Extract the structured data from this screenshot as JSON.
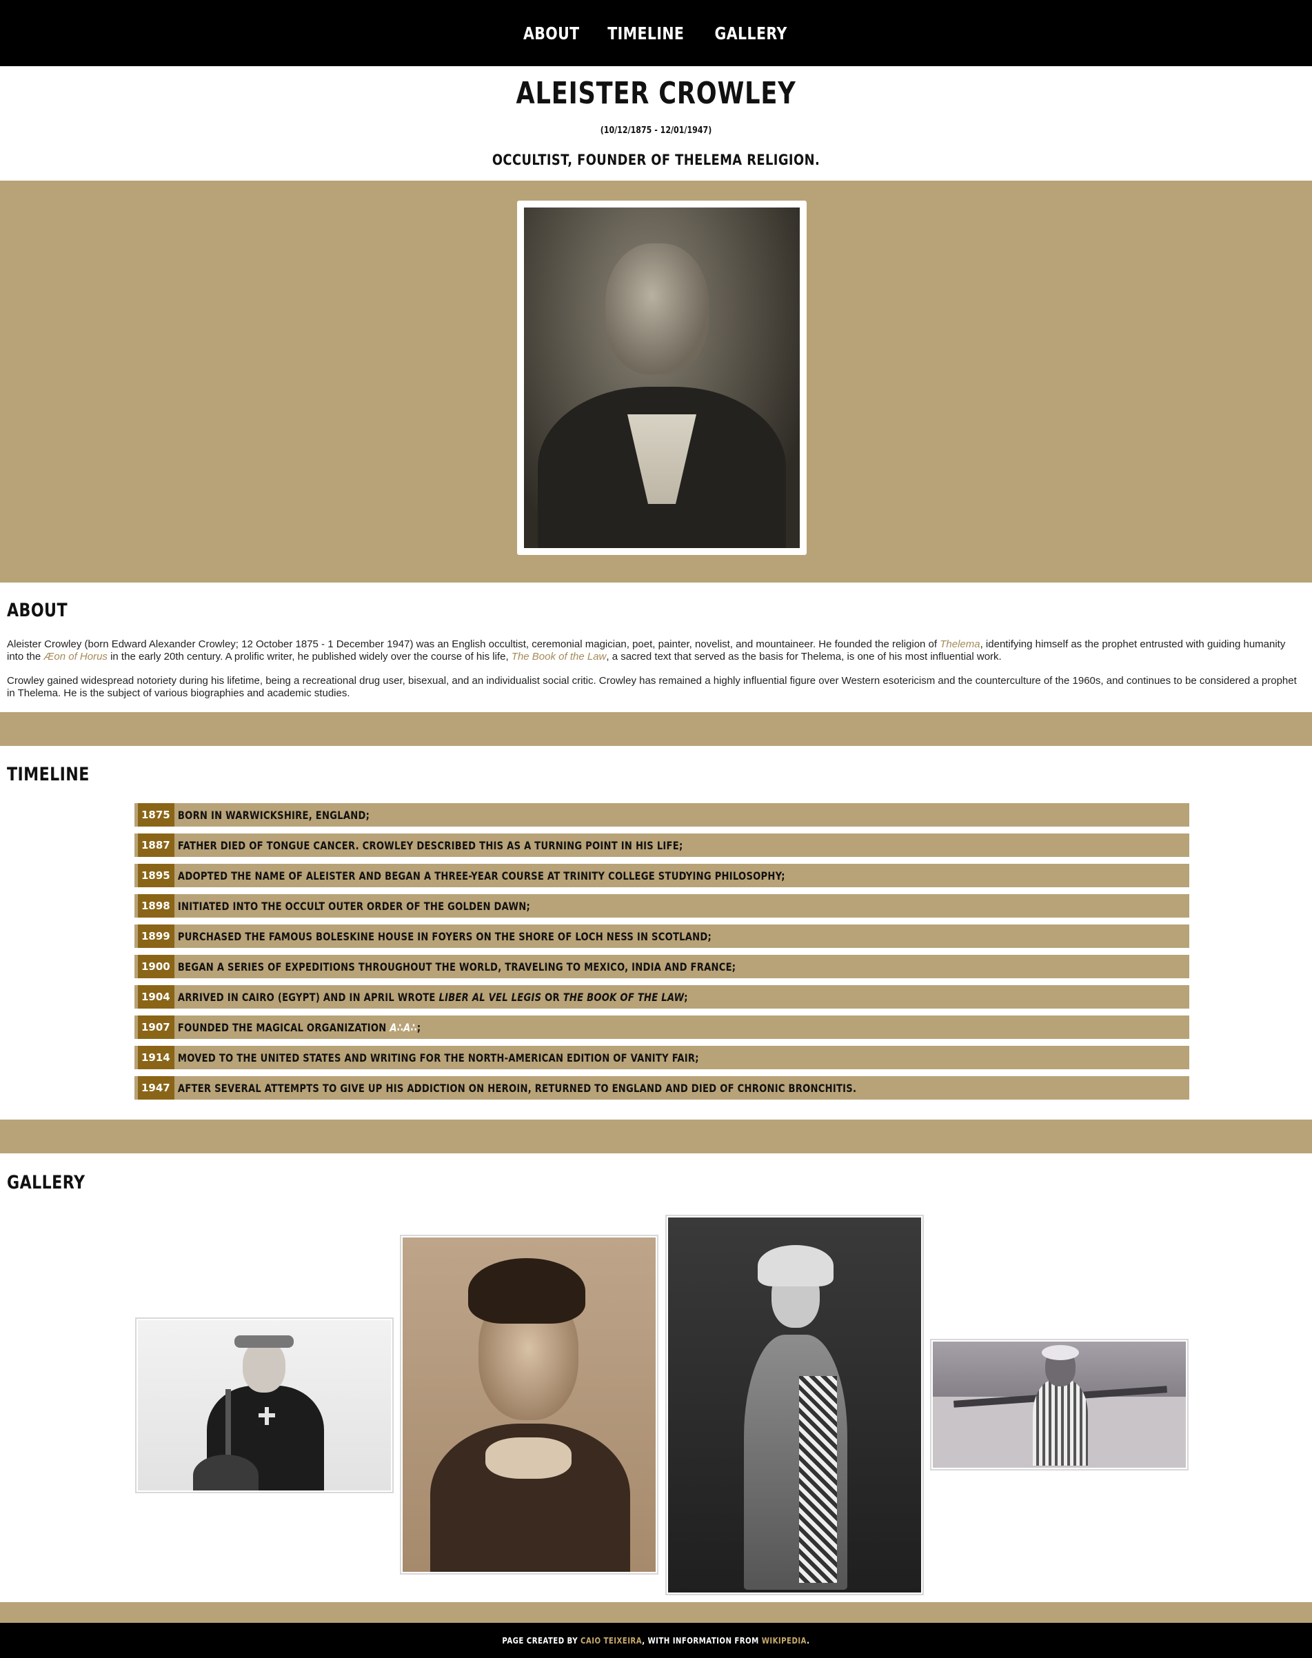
{
  "nav": {
    "items": [
      "ABOUT",
      "TIMELINE",
      "GALLERY"
    ]
  },
  "header": {
    "title": "ALEISTER CROWLEY",
    "dates": "(10/12/1875 - 12/01/1947)",
    "subtitle": "OCCULTIST, FOUNDER OF THELEMA RELIGION."
  },
  "about": {
    "heading": "ABOUT",
    "p1_a": "Aleister Crowley (born Edward Alexander Crowley; 12 October 1875 - 1 December 1947) was an English occultist, ceremonial magician, poet, painter, novelist, and mountaineer. He founded the religion of ",
    "p1_link1": "Thelema",
    "p1_b": ", identifying himself as the prophet entrusted with guiding humanity into the ",
    "p1_link2": "Æon of Horus",
    "p1_c": " in the early 20th century. A prolific writer, he published widely over the course of his life, ",
    "p1_link3": "The Book of the Law",
    "p1_d": ", a sacred text that served as the basis for Thelema, is one of his most influential work.",
    "p2": "Crowley gained widespread notoriety during his lifetime, being a recreational drug user, bisexual, and an individualist social critic. Crowley has remained a highly influential figure over Western esotericism and the counterculture of the 1960s, and continues to be considered a prophet in Thelema. He is the subject of various biographies and academic studies."
  },
  "timeline": {
    "heading": "TIMELINE",
    "events": [
      {
        "year": "1875",
        "text": "BORN IN WARWICKSHIRE, ENGLAND;"
      },
      {
        "year": "1887",
        "text": "FATHER DIED OF TONGUE CANCER. CROWLEY DESCRIBED THIS AS A TURNING POINT IN HIS LIFE;"
      },
      {
        "year": "1895",
        "text": "ADOPTED THE NAME OF ALEISTER AND BEGAN A THREE-YEAR COURSE AT TRINITY COLLEGE STUDYING PHILOSOPHY;"
      },
      {
        "year": "1898",
        "text": "INITIATED INTO THE OCCULT OUTER ORDER OF THE GOLDEN DAWN;"
      },
      {
        "year": "1899",
        "text": "PURCHASED THE FAMOUS BOLESKINE HOUSE IN FOYERS ON THE SHORE OF LOCH NESS IN SCOTLAND;"
      },
      {
        "year": "1900",
        "text": "BEGAN A SERIES OF EXPEDITIONS THROUGHOUT THE WORLD, TRAVELING TO MEXICO, INDIA AND FRANCE;"
      },
      {
        "year": "1904",
        "text_a": "ARRIVED IN CAIRO (EGYPT) AND IN APRIL WROTE ",
        "em1": "LIBER AL VEL LEGIS",
        "text_b": " OR ",
        "em2": "THE BOOK OF THE LAW",
        "text_c": ";"
      },
      {
        "year": "1907",
        "text_a": "FOUNDED THE MAGICAL ORGANIZATION ",
        "em1": "A∴A∴",
        "text_b": ";"
      },
      {
        "year": "1914",
        "text": "MOVED TO THE UNITED STATES AND WRITING FOR THE NORTH-AMERICAN EDITION OF VANITY FAIR;"
      },
      {
        "year": "1947",
        "text": "AFTER SEVERAL ATTEMPTS TO GIVE UP HIS ADDICTION ON HEROIN, RETURNED TO ENGLAND AND DIED OF CHRONIC BRONCHITIS."
      }
    ]
  },
  "gallery": {
    "heading": "GALLERY"
  },
  "footer": {
    "prefix": "PAGE CREATED BY ",
    "author": "CAIO TEIXEIRA",
    "middle": ", WITH INFORMATION FROM ",
    "source": "WIKIPEDIA",
    "suffix": "."
  },
  "colors": {
    "band": "#b8a277",
    "year_bg": "#8a6518",
    "link": "#a58a5a",
    "nav_bg": "#000000"
  }
}
